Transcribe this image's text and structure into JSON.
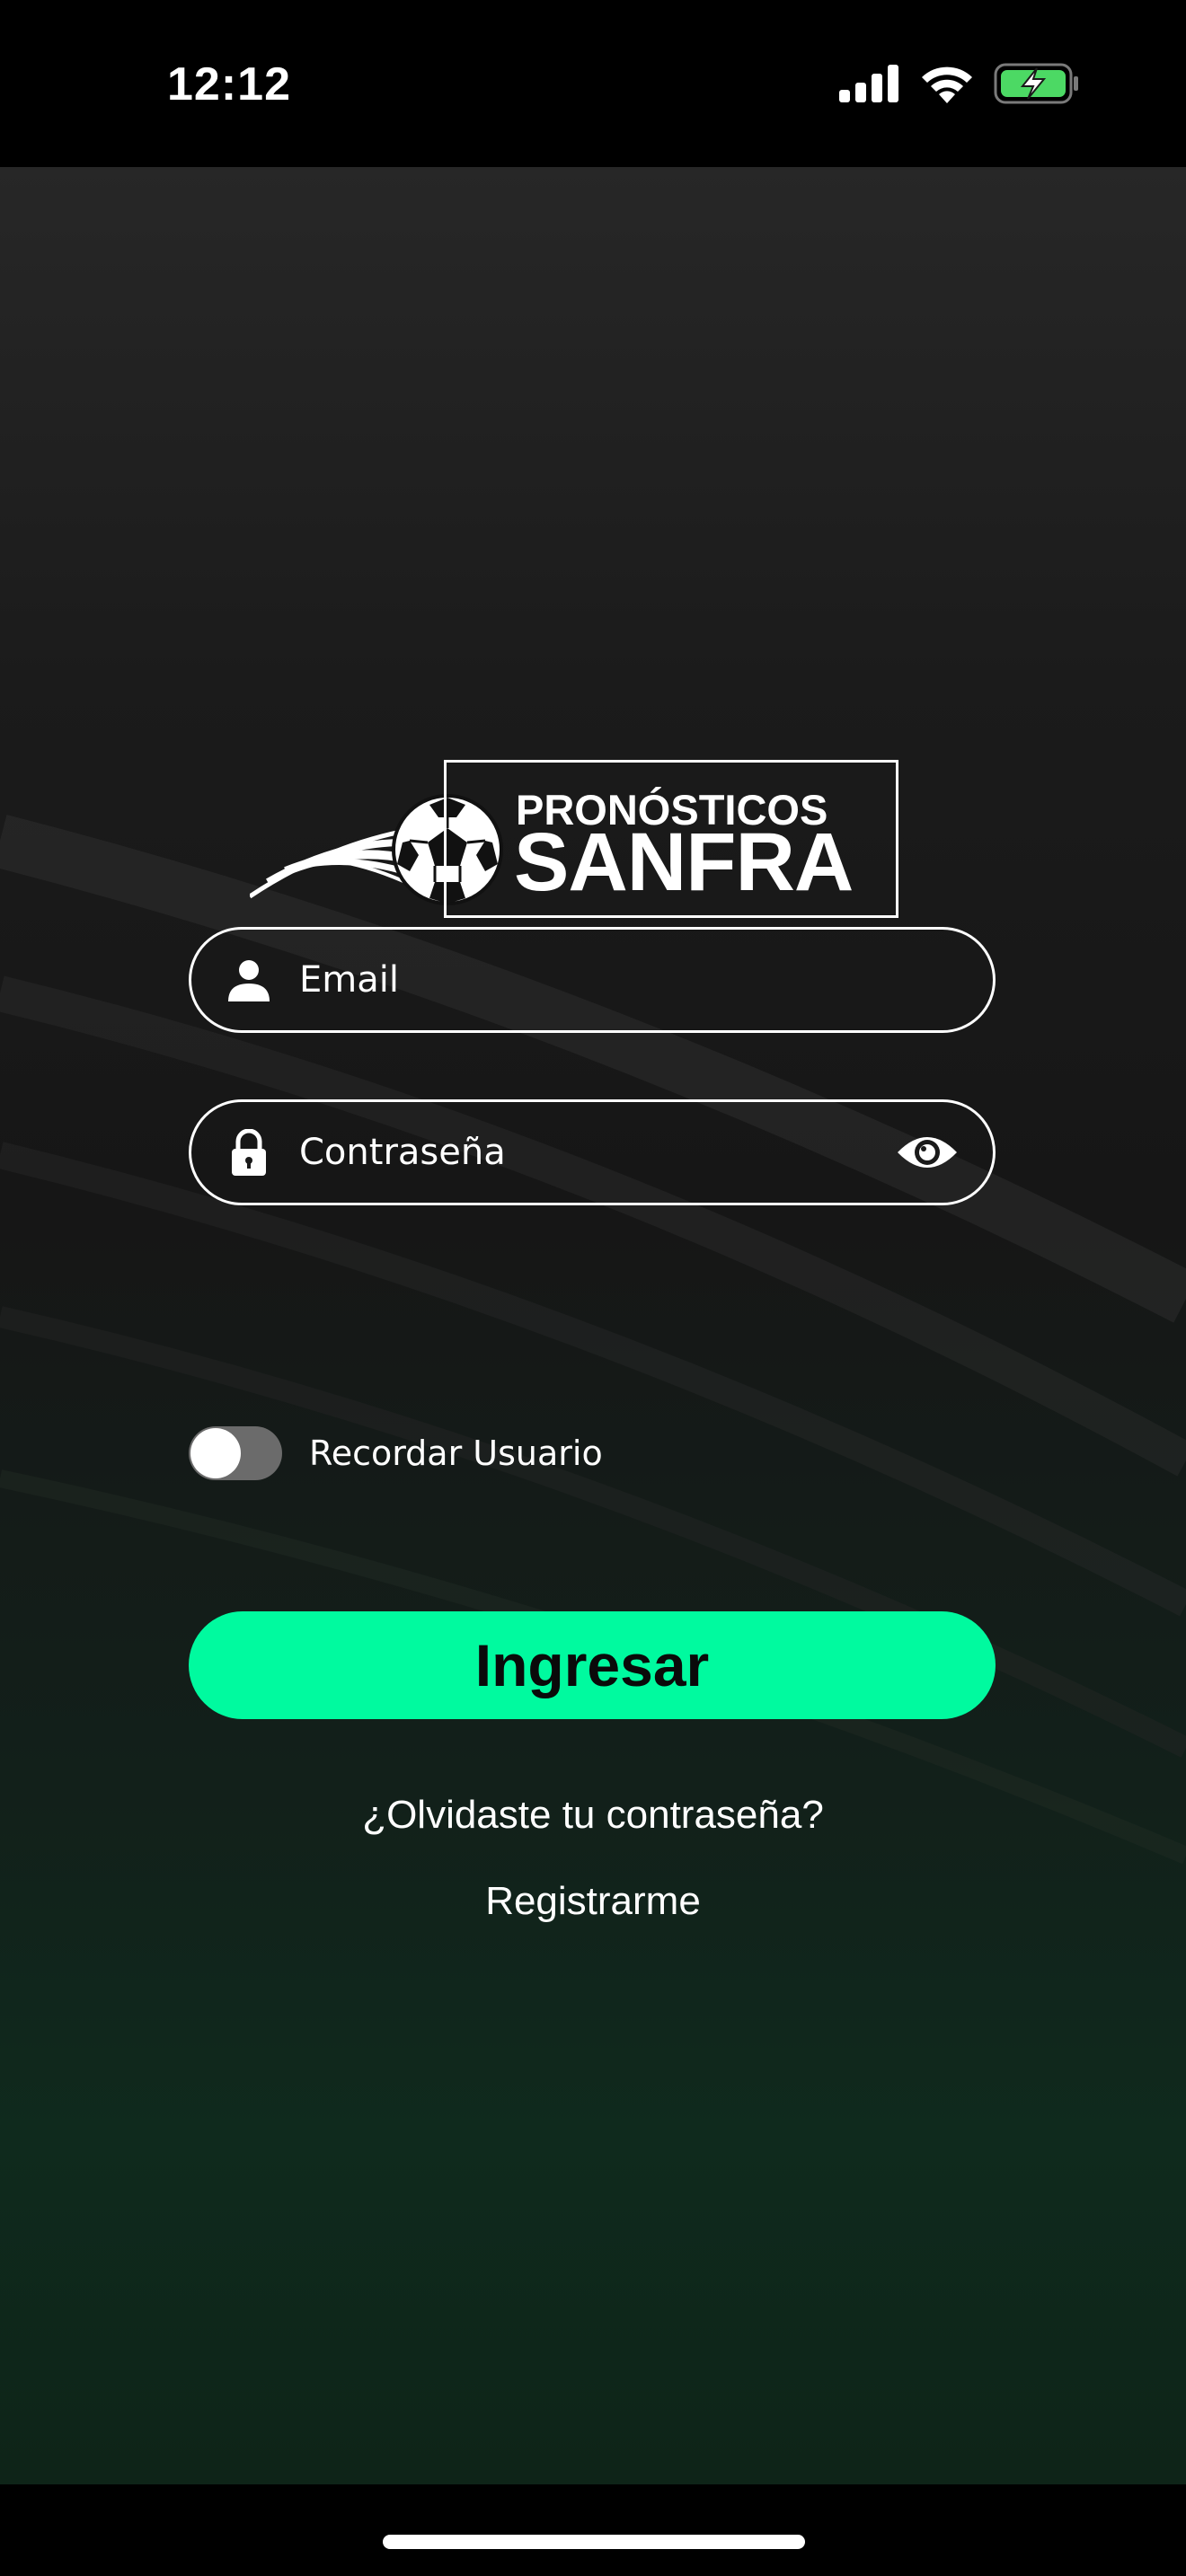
{
  "status_bar": {
    "time": "12:12",
    "icons": [
      "signal-icon",
      "wifi-icon",
      "battery-charging-icon"
    ],
    "battery_color": "#4cd964"
  },
  "logo": {
    "line1": "PRONÓSTICOS",
    "line2": "SANFRA",
    "icon": "soccer-ball-icon"
  },
  "login_form": {
    "email_placeholder": "Email",
    "email_icon": "user-icon",
    "password_placeholder": "Contraseña",
    "password_icon": "lock-icon",
    "show_password_icon": "eye-icon",
    "remember_label": "Recordar Usuario",
    "remember_checked": false,
    "submit_label": "Ingresar"
  },
  "links": {
    "forgot_password": "¿Olvidaste tu contraseña?",
    "register": "Registrarme"
  },
  "colors": {
    "accent": "#00fa9f",
    "text": "#ffffff",
    "background": "#1a1a1a"
  }
}
